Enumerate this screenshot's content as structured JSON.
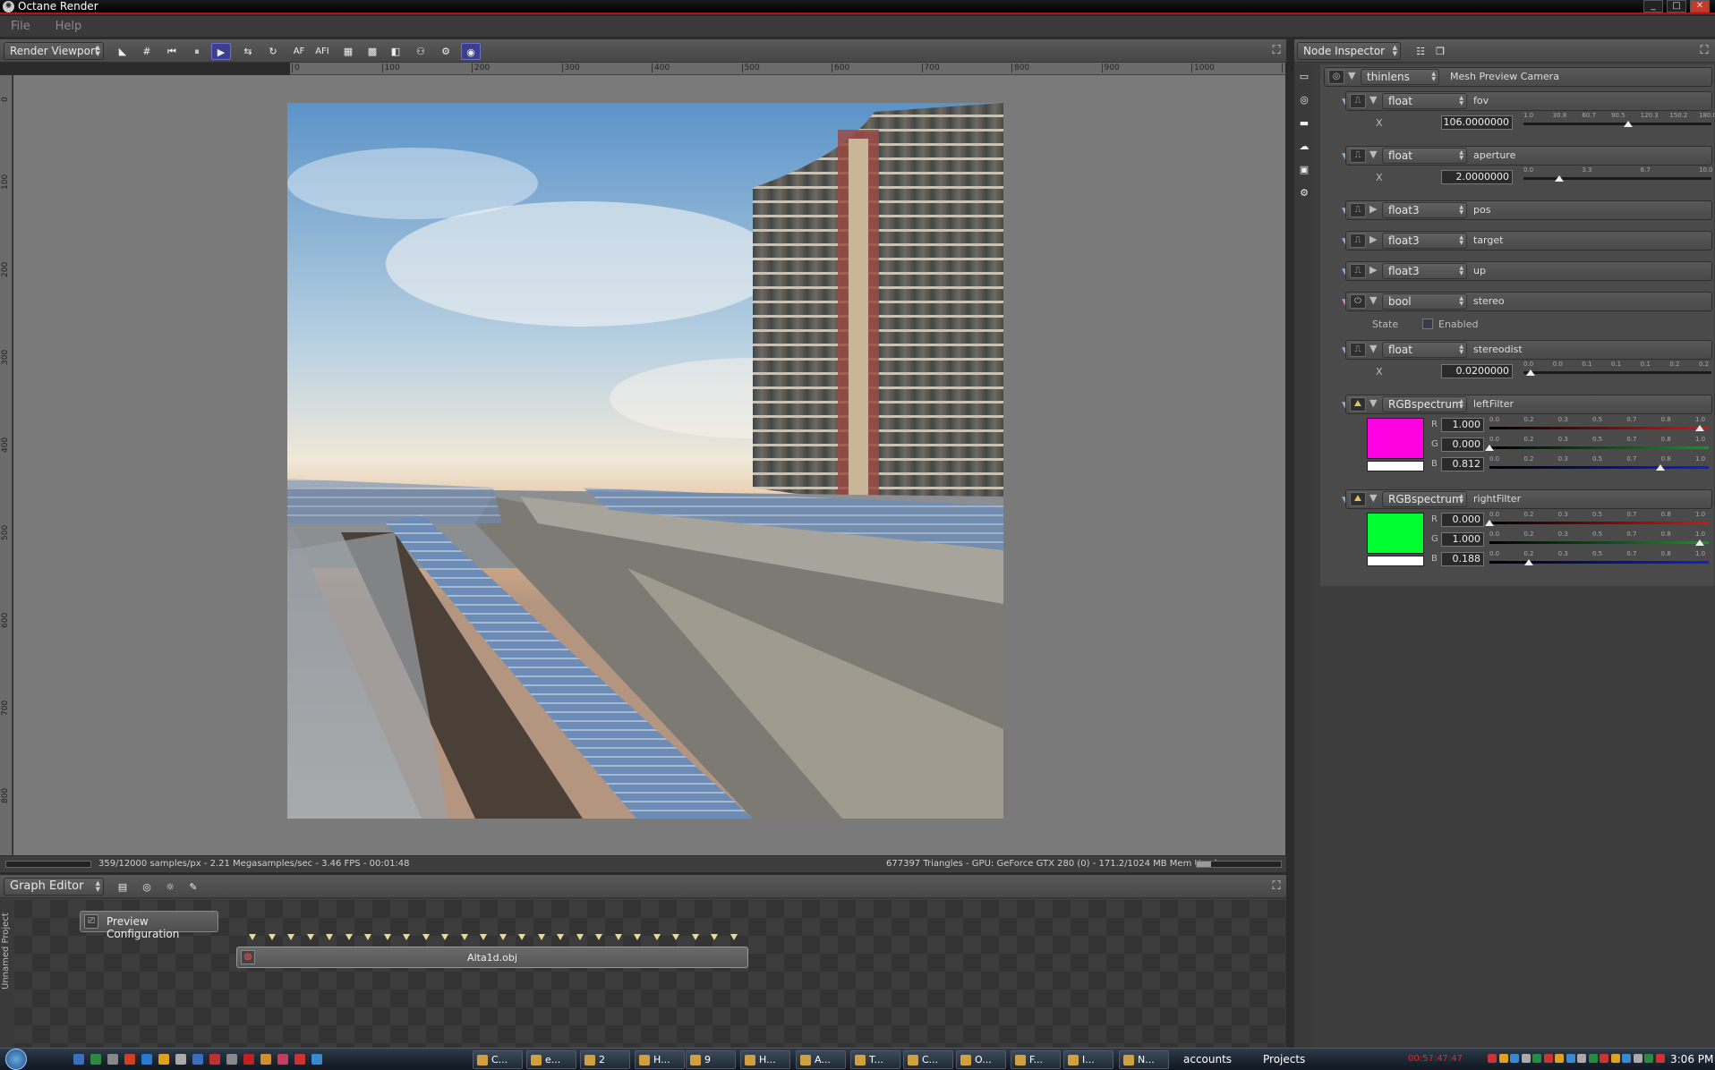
{
  "window": {
    "title": "Octane Render",
    "buttons": [
      "_",
      "□",
      "✕"
    ]
  },
  "menu": [
    "File",
    "Help"
  ],
  "render_toolbar": {
    "viewport_select": "Render Viewport",
    "af_label": "AF",
    "afi_label": "AFI"
  },
  "ruler": {
    "h_ticks": [
      "0",
      "100",
      "200",
      "300",
      "400",
      "500",
      "600",
      "700",
      "800",
      "900",
      "1000",
      "110"
    ],
    "v_ticks": [
      "0",
      "100",
      "200",
      "300",
      "400",
      "500",
      "600",
      "700",
      "800"
    ]
  },
  "status": {
    "left": "359/12000 samples/px - 2.21 Megasamples/sec - 3.46 FPS - 00:01:48",
    "right": "677397 Triangles - GPU: GeForce GTX 280 (0) - 171.2/1024 MB Mem Used"
  },
  "graph_editor": {
    "title": "Graph Editor",
    "side_tab": "Unnamed Project",
    "preview_button": "Preview Configuration",
    "node_label": "Alta1d.obj"
  },
  "inspector": {
    "title": "Node Inspector",
    "root_type": "thinlens",
    "root_name": "Mesh Preview Camera",
    "nodes": [
      {
        "type": "float",
        "name": "fov",
        "x_label": "X",
        "value": "106.0000000",
        "ticks": [
          "1.0",
          "30.8",
          "60.7",
          "90.5",
          "120.3",
          "150.2",
          "180.0"
        ],
        "pos": 0.586
      },
      {
        "type": "float",
        "name": "aperture",
        "x_label": "X",
        "value": "2.0000000",
        "ticks": [
          "0.0",
          "3.3",
          "6.7",
          "10.0"
        ],
        "pos": 0.2
      },
      {
        "type": "float3",
        "name": "pos"
      },
      {
        "type": "float3",
        "name": "target"
      },
      {
        "type": "float3",
        "name": "up"
      },
      {
        "type": "bool",
        "name": "stereo",
        "state_label": "State",
        "check_label": "Enabled"
      },
      {
        "type": "float",
        "name": "stereodist",
        "x_label": "X",
        "value": "0.0200000",
        "ticks": [
          "0.0",
          "0.0",
          "0.1",
          "0.1",
          "0.1",
          "0.2",
          "0.2"
        ],
        "pos": 0.04
      },
      {
        "type": "RGBspectrum",
        "name": "leftFilter",
        "color": "#ff00e0",
        "r": "1.000",
        "g": "0.000",
        "b": "0.812"
      },
      {
        "type": "RGBspectrum",
        "name": "rightFilter",
        "color": "#00ff30",
        "r": "0.000",
        "g": "1.000",
        "b": "0.188"
      }
    ],
    "rgb_ticks": [
      "0.0",
      "0.2",
      "0.3",
      "0.5",
      "0.7",
      "0.8",
      "1.0"
    ],
    "rgb_labels": {
      "r": "R",
      "g": "G",
      "b": "B"
    }
  },
  "taskbar": {
    "items": [
      "C...",
      "e...",
      "2",
      "H...",
      "9",
      "H...",
      "A...",
      "T...",
      "C...",
      "O...",
      "F...",
      "I...",
      "N..."
    ],
    "right_labels": [
      "accounts",
      "Projects"
    ],
    "clock": "3:06 PM",
    "tray_time": "00:57:47:47"
  }
}
